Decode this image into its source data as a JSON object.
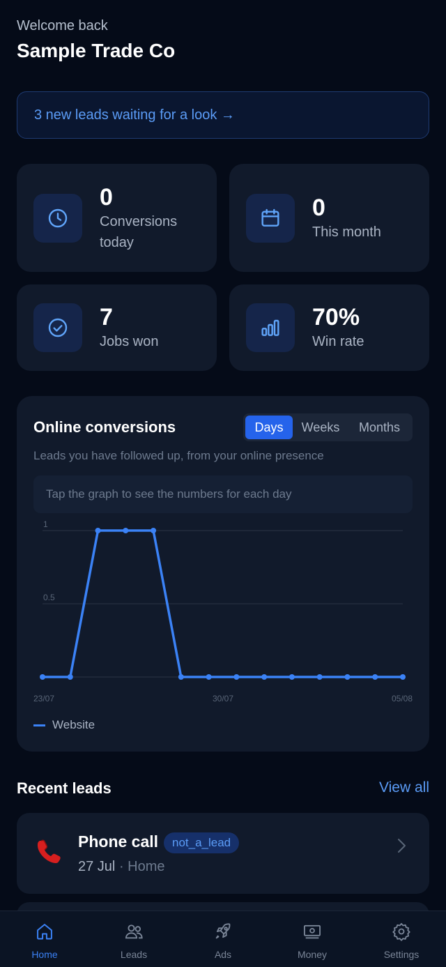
{
  "header": {
    "welcome": "Welcome back",
    "company": "Sample Trade Co"
  },
  "banner": {
    "text": "3 new leads waiting for a look →"
  },
  "stats": [
    {
      "icon": "clock-icon",
      "value": "0",
      "label": "Conversions today"
    },
    {
      "icon": "calendar-icon",
      "value": "0",
      "label": "This month"
    },
    {
      "icon": "check-circle-icon",
      "value": "7",
      "label": "Jobs won"
    },
    {
      "icon": "bar-chart-icon",
      "value": "70%",
      "label": "Win rate"
    }
  ],
  "conversions": {
    "title": "Online conversions",
    "subtitle": "Leads you have followed up, from your online presence",
    "hint": "Tap the graph to see the numbers for each day",
    "tabs": [
      "Days",
      "Weeks",
      "Months"
    ],
    "active_tab": "Days"
  },
  "chart_data": {
    "type": "line",
    "x": [
      "23/07",
      "24/07",
      "25/07",
      "26/07",
      "27/07",
      "28/07",
      "29/07",
      "30/07",
      "31/07",
      "01/08",
      "02/08",
      "03/08",
      "04/08",
      "05/08"
    ],
    "x_tick_labels": [
      "23/07",
      "30/07",
      "05/08"
    ],
    "series": [
      {
        "name": "Website",
        "values": [
          0,
          0,
          1,
          1,
          1,
          0,
          0,
          0,
          0,
          0,
          0,
          0,
          0,
          0
        ]
      }
    ],
    "y_tick_labels": [
      "1",
      "0.5"
    ],
    "ylim": [
      0,
      1
    ],
    "grid": true,
    "legend_position": "bottom-left",
    "color": "#3b82f6"
  },
  "recent": {
    "title": "Recent leads",
    "view_all": "View all"
  },
  "leads": [
    {
      "title": "Phone call",
      "badge": "not_a_lead",
      "date": "27 Jul",
      "separator": "·",
      "location": "Home",
      "icon": "phone-icon"
    }
  ],
  "tabbar": [
    {
      "label": "Home",
      "icon": "home-icon",
      "active": true
    },
    {
      "label": "Leads",
      "icon": "users-icon",
      "active": false
    },
    {
      "label": "Ads",
      "icon": "rocket-icon",
      "active": false
    },
    {
      "label": "Money",
      "icon": "banknote-icon",
      "active": false
    },
    {
      "label": "Settings",
      "icon": "gear-icon",
      "active": false
    }
  ],
  "colors": {
    "accent": "#3b82f6",
    "background": "#050b18",
    "card": "#111a2b"
  }
}
